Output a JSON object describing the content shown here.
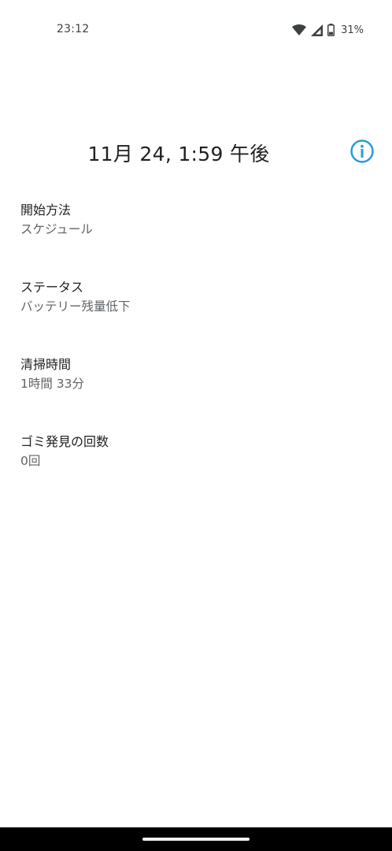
{
  "status_bar": {
    "time": "23:12",
    "battery_percent": "31%",
    "battery_level": 0.31,
    "icons": [
      "wifi-icon",
      "cell-signal-icon",
      "battery-icon"
    ]
  },
  "header": {
    "title": "11月 24, 1:59 午後",
    "info_icon": "info-icon",
    "accent_color": "#2a9bd6"
  },
  "details": [
    {
      "label": "開始方法",
      "value": "スケジュール"
    },
    {
      "label": "ステータス",
      "value": "バッテリー残量低下"
    },
    {
      "label": "清掃時間",
      "value": "1時間 33分"
    },
    {
      "label": "ゴミ発見の回数",
      "value": "0回"
    }
  ]
}
